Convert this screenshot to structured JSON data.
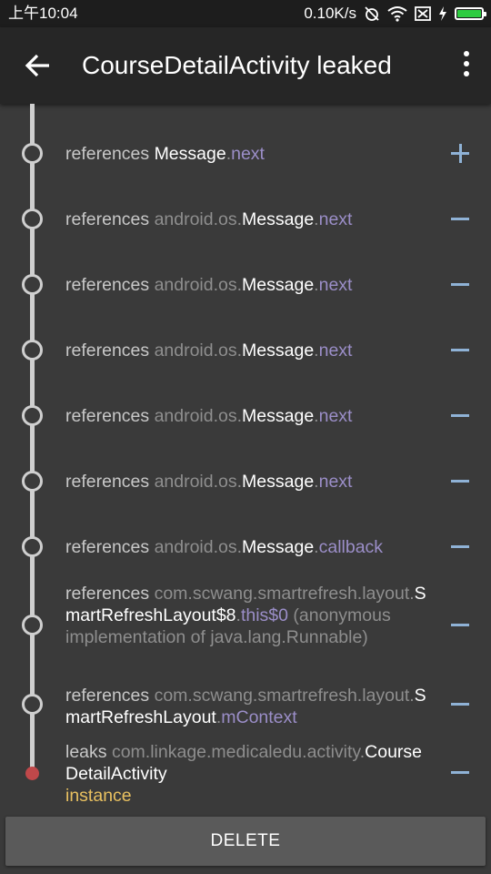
{
  "status_bar": {
    "time": "上午10:04",
    "network_speed": "0.10K/s",
    "battery_level": 1.0,
    "icons": [
      "alarm-off-icon",
      "wifi-icon",
      "sim-off-icon",
      "charging-icon",
      "battery-icon"
    ]
  },
  "toolbar": {
    "title": "CourseDetailActivity leaked",
    "back_icon": "arrow-left-icon",
    "menu_icon": "overflow-menu-icon"
  },
  "trace": {
    "rows": [
      {
        "label": "references",
        "pkg": "",
        "cls": "Message",
        "sep": ".",
        "field": "next",
        "toggle": "plus"
      },
      {
        "label": "references",
        "pkg": "android.os.",
        "cls": "Message",
        "sep": ".",
        "field": "next",
        "toggle": "minus"
      },
      {
        "label": "references",
        "pkg": "android.os.",
        "cls": "Message",
        "sep": ".",
        "field": "next",
        "toggle": "minus"
      },
      {
        "label": "references",
        "pkg": "android.os.",
        "cls": "Message",
        "sep": ".",
        "field": "next",
        "toggle": "minus"
      },
      {
        "label": "references",
        "pkg": "android.os.",
        "cls": "Message",
        "sep": ".",
        "field": "next",
        "toggle": "minus"
      },
      {
        "label": "references",
        "pkg": "android.os.",
        "cls": "Message",
        "sep": ".",
        "field": "next",
        "toggle": "minus"
      },
      {
        "label": "references",
        "pkg": "android.os.",
        "cls": "Message",
        "sep": ".",
        "field": "callback",
        "toggle": "minus"
      },
      {
        "label": "references",
        "pkg": "com.scwang.smartrefresh.layout.",
        "cls": "SmartRefreshLayout$8",
        "sep": ".",
        "field": "this$0",
        "extra": " (anonymous implementation of java.lang.Runnable)",
        "toggle": "minus"
      },
      {
        "label": "references",
        "pkg": "com.scwang.smartrefresh.layout.",
        "cls": "SmartRefreshLayout",
        "sep": ".",
        "field": "mContext",
        "toggle": "minus"
      }
    ],
    "leak": {
      "label": "leaks",
      "pkg": "com.linkage.medicaledu.activity.",
      "cls": "CourseDetailActivity",
      "instance": "instance",
      "toggle": "minus"
    }
  },
  "actions": {
    "delete_label": "DELETE"
  },
  "colors": {
    "background": "#3a3a3a",
    "toolbar": "#262626",
    "field": "#9b8ec8",
    "instance": "#e8c060",
    "toggle": "#8fb2d6",
    "leak_dot": "#c0484a"
  }
}
